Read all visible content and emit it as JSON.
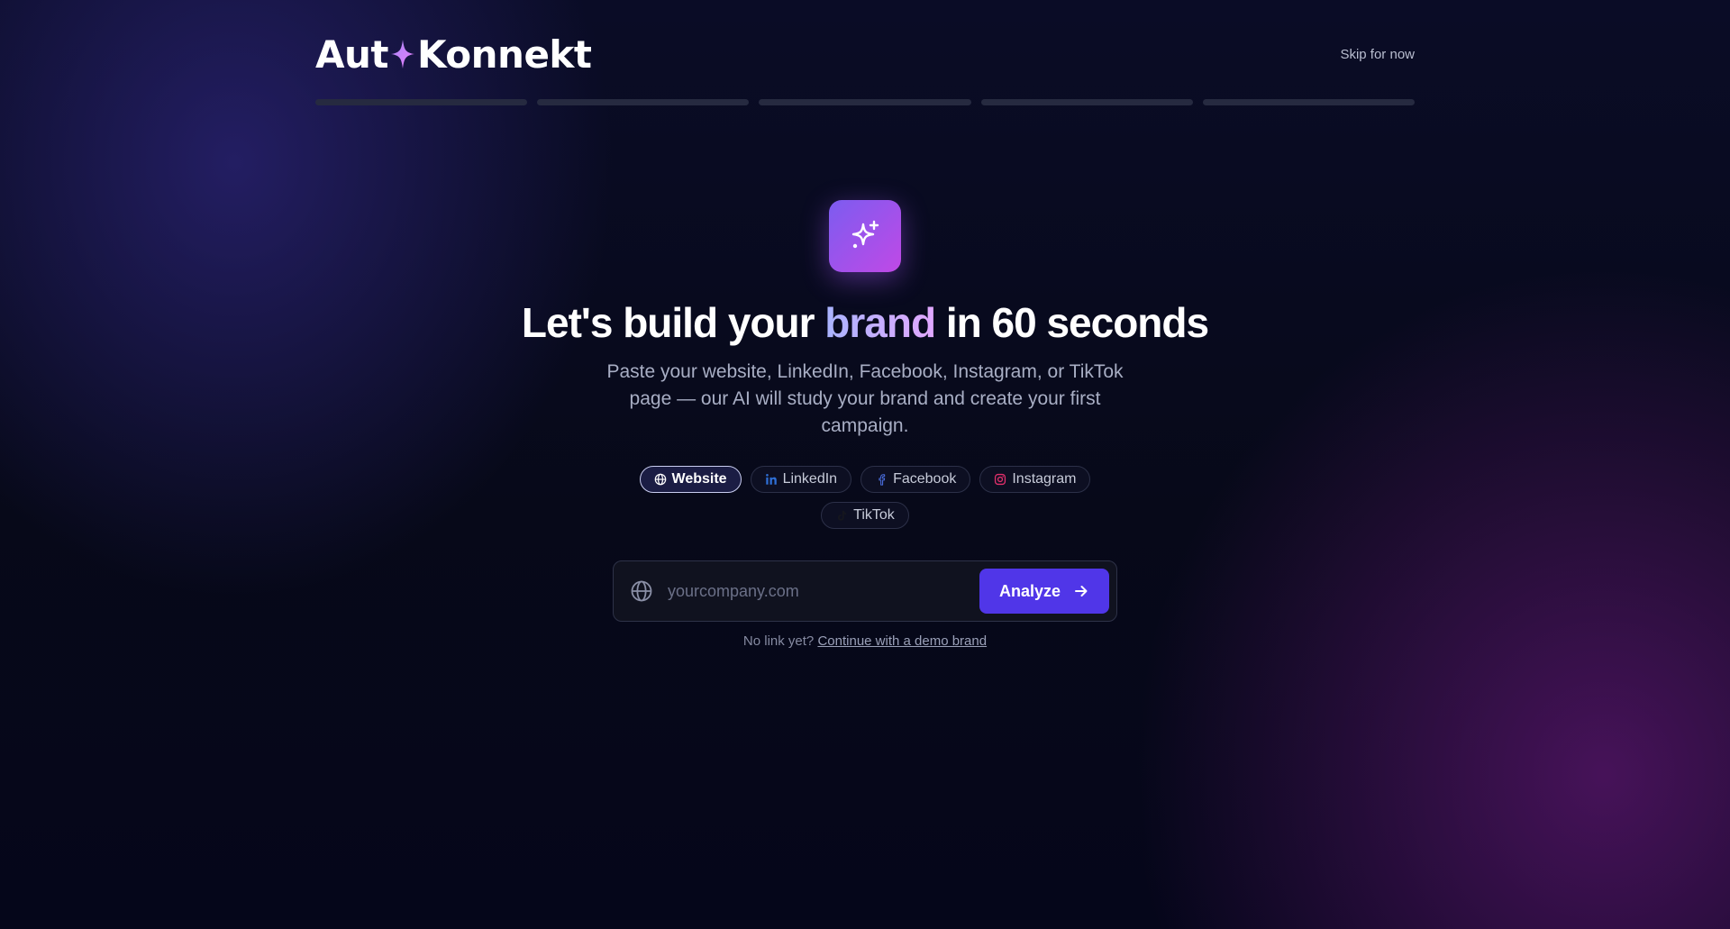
{
  "header": {
    "logo_part1": "Aut",
    "logo_part2": "Konnekt",
    "skip_label": "Skip for now"
  },
  "progress": {
    "total_steps": 5,
    "completed_steps": 0
  },
  "hero": {
    "icon": "sparkles-icon",
    "headline_pre": "Let's build your ",
    "headline_accent": "brand",
    "headline_post": " in 60 seconds",
    "subtitle": "Paste your website, LinkedIn, Facebook, Instagram, or TikTok page — our AI will study your brand and create your first campaign."
  },
  "sources": {
    "selected": "Website",
    "items": [
      {
        "label": "Website",
        "icon": "globe-icon",
        "color": "#ffffff"
      },
      {
        "label": "LinkedIn",
        "icon": "linkedin-icon",
        "color": "#2f6fd6"
      },
      {
        "label": "Facebook",
        "icon": "facebook-icon",
        "color": "#4a6ee0"
      },
      {
        "label": "Instagram",
        "icon": "instagram-icon",
        "color": "#e1306c"
      },
      {
        "label": "TikTok",
        "icon": "tiktok-icon",
        "color": "#1a1a22"
      }
    ]
  },
  "url_form": {
    "icon": "globe-icon",
    "placeholder": "yourcompany.com",
    "value": "",
    "button_label": "Analyze",
    "button_icon": "arrow-right-icon"
  },
  "footer_note": {
    "prefix": "No link yet? ",
    "link_label": "Continue with a demo brand"
  },
  "colors": {
    "accent": "#5036e8",
    "brand_gradient_start": "#7c5cf0",
    "brand_gradient_end": "#c049e6"
  }
}
